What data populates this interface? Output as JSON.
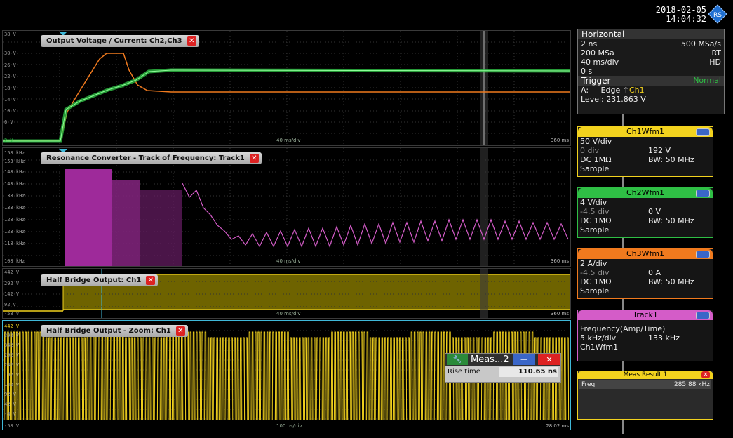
{
  "header": {
    "date": "2018-02-05",
    "time": "14:04:32",
    "logo_text": "RS"
  },
  "panels": [
    {
      "title": "Output Voltage / Current: Ch2,Ch3",
      "ylabels": [
        "38 V",
        "30 V",
        "26 V",
        "22 V",
        "18 V",
        "14 V",
        "10 V",
        "6 V",
        "2 V"
      ],
      "time_div": "40 ms/div",
      "time_end": "360 ms"
    },
    {
      "title": "Resonance Converter - Track of Frequency: Track1",
      "ylabels": [
        "158 kHz",
        "153 kHz",
        "148 kHz",
        "143 kHz",
        "138 kHz",
        "133 kHz",
        "128 kHz",
        "123 kHz",
        "118 kHz",
        "108 kHz"
      ],
      "time_div": "40 ms/div",
      "time_end": "360 ms"
    },
    {
      "title": "Half Bridge Output: Ch1",
      "ylabels": [
        "442 V",
        "292 V",
        "142 V",
        "92 V",
        "-58 V"
      ],
      "time_div": "40 ms/div",
      "time_end": "360 ms"
    },
    {
      "title": "Half Bridge Output - Zoom: Ch1",
      "ylabels": [
        "442 V",
        "392 V",
        "342 V",
        "292 V",
        "242 V",
        "192 V",
        "142 V",
        "92 V",
        "42 V",
        "-8 V",
        "-58 V"
      ],
      "time_div": "100 µs/div",
      "time_end": "28.02 ms"
    }
  ],
  "horizontal": {
    "title": "Horizontal",
    "time_scale": "2 ns",
    "sample_rate": "500 MSa/s",
    "record": "200 MSa",
    "mode": "RT",
    "div": "40 ms/div",
    "res": "HD",
    "pos": "0 s"
  },
  "trigger": {
    "title": "Trigger",
    "state": "Normal",
    "source_label": "A:",
    "type": "Edge",
    "channel": "Ch1",
    "level": "Level: 231.863 V"
  },
  "channels": [
    {
      "name": "Ch1Wfm1",
      "color": "#f2d21e",
      "scale": "50 V/div",
      "offset_label": "0 div",
      "offset_value": "192 V",
      "coupling": "DC 1MΩ",
      "bw": "BW: 50 MHz",
      "mode": "Sample"
    },
    {
      "name": "Ch2Wfm1",
      "color": "#2fbf45",
      "scale": "4 V/div",
      "offset_label": "-4.5 div",
      "offset_value": "0 V",
      "coupling": "DC 1MΩ",
      "bw": "BW: 50 MHz",
      "mode": "Sample"
    },
    {
      "name": "Ch3Wfm1",
      "color": "#f07a1e",
      "scale": "2 A/div",
      "offset_label": "-4.5 div",
      "offset_value": "0 A",
      "coupling": "DC 1MΩ",
      "bw": "BW: 50 MHz",
      "mode": "Sample"
    }
  ],
  "track": {
    "name": "Track1",
    "color": "#d45cc8",
    "line1": "Frequency(Amp/Time)",
    "scale": "5 kHz/div",
    "value": "133 kHz",
    "source": "Ch1Wfm1"
  },
  "meas_result": {
    "title": "Meas Result 1",
    "label": "Freq",
    "value": "285.88 kHz"
  },
  "meas_popup": {
    "title": "Meas...2",
    "label": "Rise time",
    "value": "110.65 ns"
  },
  "colors": {
    "ch1": "#f2d21e",
    "ch2": "#2fbf45",
    "ch3": "#f07a1e",
    "track": "#d45cc8"
  }
}
